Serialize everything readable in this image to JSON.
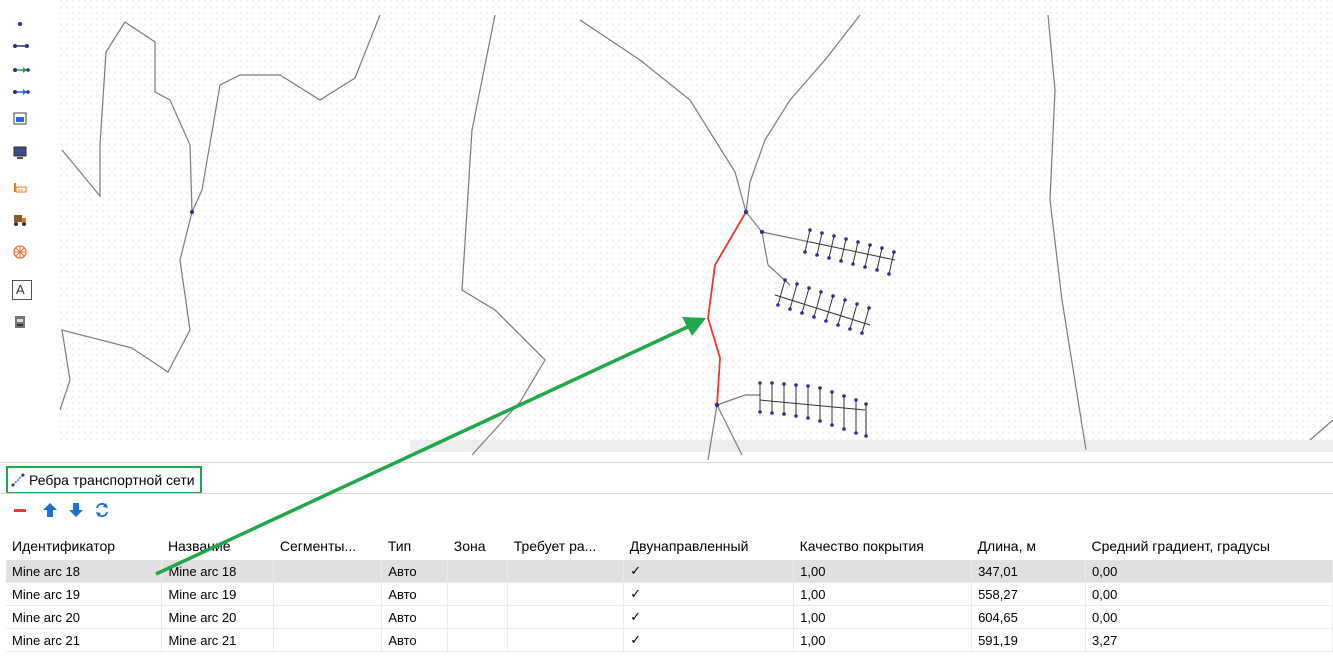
{
  "toolbar": {
    "tools": [
      {
        "name": "node-tool-icon"
      },
      {
        "name": "edge-tool-icon"
      },
      {
        "name": "directed-edge-green-icon"
      },
      {
        "name": "directed-edge-blue-icon"
      },
      {
        "name": "loading-point-icon"
      },
      {
        "name": "monitor-icon"
      },
      {
        "name": "factory-icon"
      },
      {
        "name": "dump-truck-icon"
      },
      {
        "name": "ventilation-fan-icon"
      },
      {
        "name": "text-label-icon"
      },
      {
        "name": "storage-icon"
      }
    ]
  },
  "panel": {
    "tab_title": "Ребра транспортной сети"
  },
  "table": {
    "columns": [
      "Идентификатор",
      "Название",
      "Сегменты...",
      "Тип",
      "Зона",
      "Требует ра...",
      "Двунаправленный",
      "Качество покрытия",
      "Длина, м",
      "Средний градиент, градусы"
    ],
    "rows": [
      [
        "Mine arc 18",
        "Mine arc 18",
        "",
        "Авто",
        "",
        "",
        "✓",
        "1,00",
        "347,01",
        "0,00"
      ],
      [
        "Mine arc 19",
        "Mine arc 19",
        "",
        "Авто",
        "",
        "",
        "✓",
        "1,00",
        "558,27",
        "0,00"
      ],
      [
        "Mine arc 20",
        "Mine arc 20",
        "",
        "Авто",
        "",
        "",
        "✓",
        "1,00",
        "604,65",
        "0,00"
      ],
      [
        "Mine arc 21",
        "Mine arc 21",
        "",
        "Авто",
        "",
        "",
        "✓",
        "1,00",
        "591,19",
        "3,27"
      ]
    ],
    "selected_row": 0
  },
  "colors": {
    "highlight_edge": "#e53935",
    "annotation_arrow": "#1fa84a",
    "node": "#2b2f8a",
    "edge": "#7a7a7a"
  }
}
